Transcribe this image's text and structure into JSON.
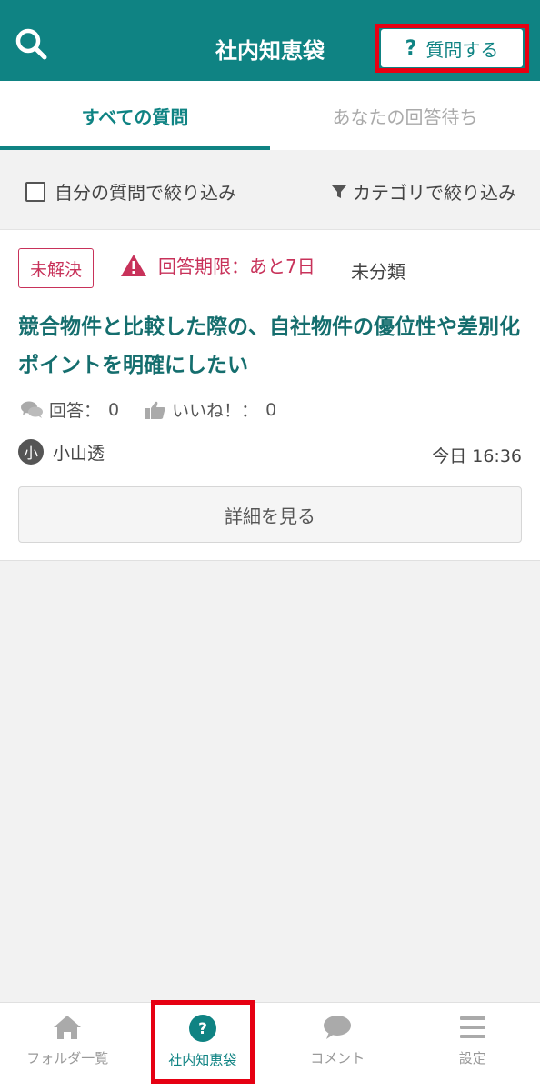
{
  "header": {
    "title": "社内知恵袋",
    "search_icon": "search-icon",
    "ask_button": {
      "icon_text": "?",
      "label": "質問する"
    }
  },
  "tabs": [
    {
      "label": "すべての質問",
      "active": true
    },
    {
      "label": "あなたの回答待ち",
      "active": false
    }
  ],
  "filters": {
    "mine_label": "自分の質問で絞り込み",
    "category_label": "カテゴリで絞り込み"
  },
  "question": {
    "status": "未解決",
    "deadline": "回答期限：あと7日",
    "category": "未分類",
    "title": "競合物件と比較した際の、自社物件の優位性や差別化ポイントを明確にしたい",
    "answers_label": "回答：",
    "answers_count": "0",
    "likes_label": "いいね！：",
    "likes_count": "0",
    "author_initial": "小",
    "author": "小山透",
    "timestamp": "今日 16:36",
    "detail_button": "詳細を見る"
  },
  "bottom_nav": [
    {
      "label": "フォルダ一覧",
      "icon": "home-icon",
      "active": false
    },
    {
      "label": "社内知恵袋",
      "icon": "question-circle-icon",
      "active": true
    },
    {
      "label": "コメント",
      "icon": "speech-bubble-icon",
      "active": false
    },
    {
      "label": "設定",
      "icon": "menu-icon",
      "active": false
    }
  ],
  "colors": {
    "brand": "#0f8383",
    "alert": "#c8325a",
    "highlight": "#e60012"
  }
}
